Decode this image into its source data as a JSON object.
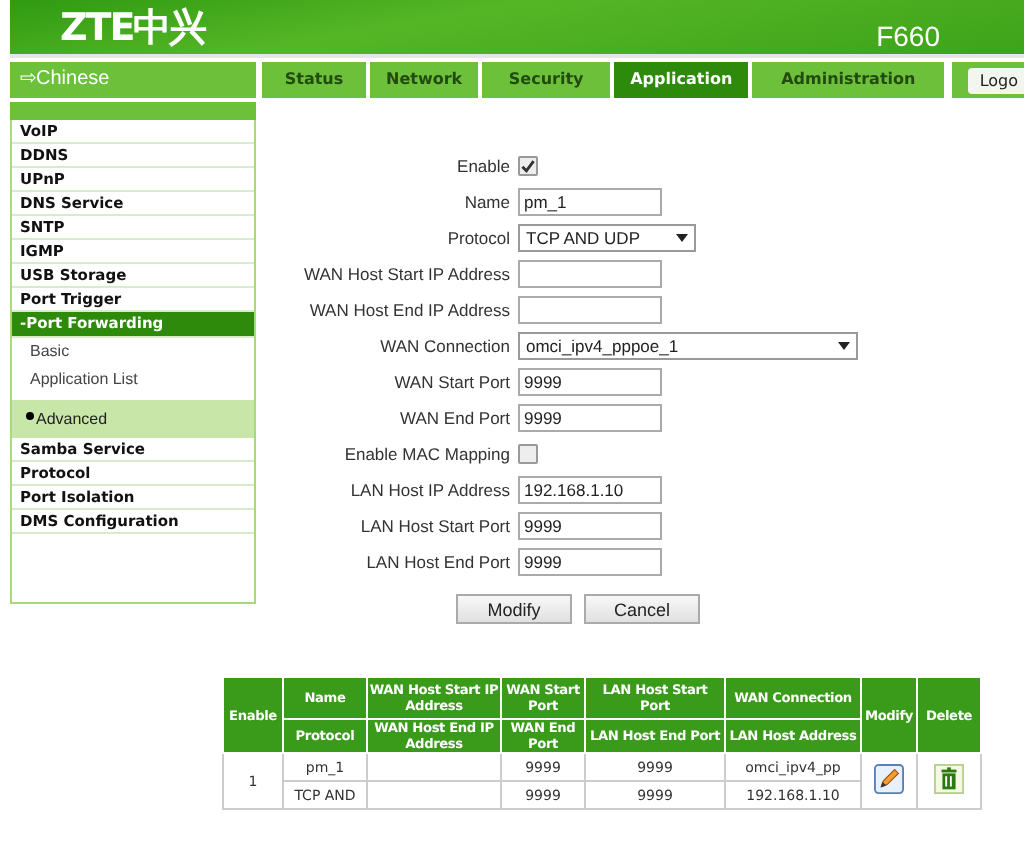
{
  "header": {
    "logo": "ZTE中兴",
    "model": "F660"
  },
  "language_link": "⇨Chinese",
  "tabs": [
    {
      "label": "Status",
      "selected": false
    },
    {
      "label": "Network",
      "selected": false
    },
    {
      "label": "Security",
      "selected": false
    },
    {
      "label": "Application",
      "selected": true
    },
    {
      "label": "Administration",
      "selected": false
    }
  ],
  "logout_button": "Logo",
  "sidebar": {
    "items": [
      {
        "label": "VoIP",
        "expanded": false
      },
      {
        "label": "DDNS",
        "expanded": false
      },
      {
        "label": "UPnP",
        "expanded": false
      },
      {
        "label": "DNS Service",
        "expanded": false
      },
      {
        "label": "SNTP",
        "expanded": false
      },
      {
        "label": "IGMP",
        "expanded": false
      },
      {
        "label": "USB Storage",
        "expanded": false
      },
      {
        "label": "Port Trigger",
        "expanded": false
      },
      {
        "label": "-Port Forwarding",
        "expanded": true,
        "children": [
          {
            "label": "Basic",
            "selected": false
          },
          {
            "label": "Application List",
            "selected": false
          },
          {
            "label": "Advanced",
            "selected": true
          }
        ]
      },
      {
        "label": "Samba Service",
        "expanded": false
      },
      {
        "label": "Protocol",
        "expanded": false
      },
      {
        "label": "Port Isolation",
        "expanded": false
      },
      {
        "label": "DMS Configuration",
        "expanded": false
      }
    ]
  },
  "form": {
    "fields": [
      {
        "label": "Enable",
        "kind": "checkbox",
        "checked": true
      },
      {
        "label": "Name",
        "kind": "text",
        "value": "pm_1"
      },
      {
        "label": "Protocol",
        "kind": "select",
        "value": "TCP AND UDP"
      },
      {
        "label": "WAN Host Start IP Address",
        "kind": "text"
      },
      {
        "label": "WAN Host End IP Address",
        "kind": "text"
      },
      {
        "label": "WAN Connection",
        "kind": "wide-select",
        "value": "omci_ipv4_pppoe_1"
      },
      {
        "label": "WAN Start Port",
        "kind": "text",
        "value": "9999"
      },
      {
        "label": "WAN End Port",
        "kind": "text",
        "value": "9999"
      },
      {
        "label": "Enable MAC Mapping",
        "kind": "checkbox",
        "checked": false
      },
      {
        "label": "LAN Host IP Address",
        "kind": "text",
        "value": "192.168.1.10"
      },
      {
        "label": "LAN Host Start Port",
        "kind": "text",
        "value": "9999"
      },
      {
        "label": "LAN Host End Port",
        "kind": "text",
        "value": "9999"
      }
    ],
    "buttons": [
      "Modify",
      "Cancel"
    ]
  },
  "table": {
    "header_top": [
      "Enable",
      "Name",
      "WAN Host Start IP Address",
      "WAN Start Port",
      "LAN Host Start Port",
      "WAN Connection",
      "Modify",
      "Delete"
    ],
    "header_bottom": [
      "Protocol",
      "WAN Host End IP Address",
      "WAN End Port",
      "LAN Host End Port",
      "LAN Host Address"
    ],
    "rows": [
      {
        "index": "1",
        "top": {
          "name": "pm_1",
          "wan_start_port": "9999",
          "lan_start_port": "9999",
          "wan_connection": "omci_ipv4_pp"
        },
        "bottom": {
          "protocol": "TCP AND",
          "wan_end_port": "9999",
          "lan_end_port": "9999",
          "lan_host_address": "192.168.1.10"
        }
      }
    ]
  }
}
